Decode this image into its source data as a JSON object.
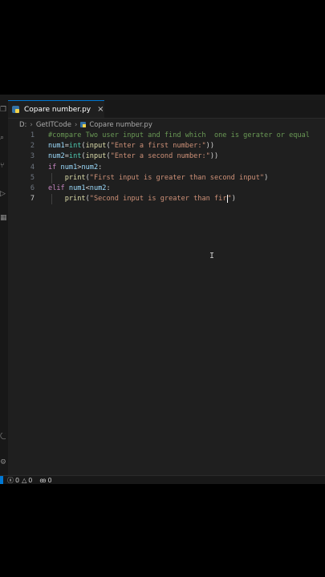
{
  "tab": {
    "filename": "Copare number.py",
    "close_icon": "×"
  },
  "breadcrumb": {
    "drive": "D:",
    "folder": "GetITCode",
    "file": "Copare number.py",
    "separator": "›"
  },
  "editor": {
    "line_numbers": [
      "1",
      "2",
      "3",
      "4",
      "5",
      "6",
      "7"
    ],
    "active_line": "7",
    "lines": [
      [
        {
          "t": "cmt",
          "v": "#compare Two user input and find which  one is gerater or equal"
        }
      ],
      [
        {
          "t": "var",
          "v": "num1"
        },
        {
          "t": "op",
          "v": "="
        },
        {
          "t": "cls",
          "v": "int"
        },
        {
          "t": "op",
          "v": "("
        },
        {
          "t": "fn",
          "v": "input"
        },
        {
          "t": "op",
          "v": "("
        },
        {
          "t": "str",
          "v": "\"Enter a first number:\""
        },
        {
          "t": "op",
          "v": "))"
        }
      ],
      [
        {
          "t": "var",
          "v": "num2"
        },
        {
          "t": "op",
          "v": "="
        },
        {
          "t": "cls",
          "v": "int"
        },
        {
          "t": "op",
          "v": "("
        },
        {
          "t": "fn",
          "v": "input"
        },
        {
          "t": "op",
          "v": "("
        },
        {
          "t": "str",
          "v": "\"Enter a second number:\""
        },
        {
          "t": "op",
          "v": "))"
        }
      ],
      [
        {
          "t": "kw",
          "v": "if"
        },
        {
          "t": "op",
          "v": " "
        },
        {
          "t": "var",
          "v": "num1"
        },
        {
          "t": "op",
          "v": ">"
        },
        {
          "t": "var",
          "v": "num2"
        },
        {
          "t": "op",
          "v": ":"
        }
      ],
      [
        {
          "t": "op",
          "v": "    "
        },
        {
          "t": "fn",
          "v": "print"
        },
        {
          "t": "op",
          "v": "("
        },
        {
          "t": "str",
          "v": "\"First input is greater than second input\""
        },
        {
          "t": "op",
          "v": ")"
        }
      ],
      [
        {
          "t": "kw",
          "v": "elif"
        },
        {
          "t": "op",
          "v": " "
        },
        {
          "t": "var",
          "v": "num1"
        },
        {
          "t": "op",
          "v": "<"
        },
        {
          "t": "var",
          "v": "num2"
        },
        {
          "t": "op",
          "v": ":"
        }
      ],
      [
        {
          "t": "op",
          "v": "    "
        },
        {
          "t": "fn",
          "v": "print"
        },
        {
          "t": "op",
          "v": "("
        },
        {
          "t": "str",
          "v": "\"Second input is greater than fir"
        },
        {
          "t": "cursor",
          "v": ""
        },
        {
          "t": "str",
          "v": "\""
        },
        {
          "t": "op",
          "v": ")"
        }
      ]
    ]
  },
  "status": {
    "errors": "0",
    "warnings": "0",
    "ports": "0",
    "error_icon": "ⓧ",
    "warning_icon": "△",
    "ports_icon": "ꙭ"
  },
  "icons": {
    "activity": [
      "files-icon",
      "search-icon",
      "source-control-icon",
      "run-debug-icon",
      "extensions-icon",
      "testing-icon"
    ],
    "account": "account-icon",
    "settings": "gear-icon"
  },
  "colors": {
    "accent": "#0078d4",
    "editor_bg": "#1f1f1f",
    "comment": "#6a9955",
    "string": "#ce9178",
    "keyword": "#c586c0",
    "function": "#dcdcaa",
    "variable": "#9cdcfe"
  }
}
